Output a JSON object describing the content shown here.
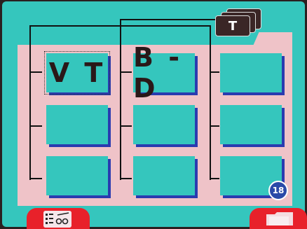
{
  "tiles": [
    {
      "label": "V T"
    },
    {
      "label": "B - D"
    },
    {
      "label": ""
    },
    {
      "label": ""
    },
    {
      "label": ""
    },
    {
      "label": ""
    },
    {
      "label": ""
    },
    {
      "label": ""
    },
    {
      "label": ""
    }
  ],
  "top_icon": {
    "label": "T",
    "icon": "folder-stack-icon"
  },
  "badge": {
    "value": "18"
  },
  "buttons": {
    "left_icon": "chart-edit-icon",
    "right_icon": "folder-icon"
  },
  "colors": {
    "background": "#35c6bd",
    "panel": "#efc3c8",
    "tile": "#35c6bd",
    "tile_shadow": "#2a3bb0",
    "button": "#e8212a",
    "badge": "#2a4aa8"
  }
}
